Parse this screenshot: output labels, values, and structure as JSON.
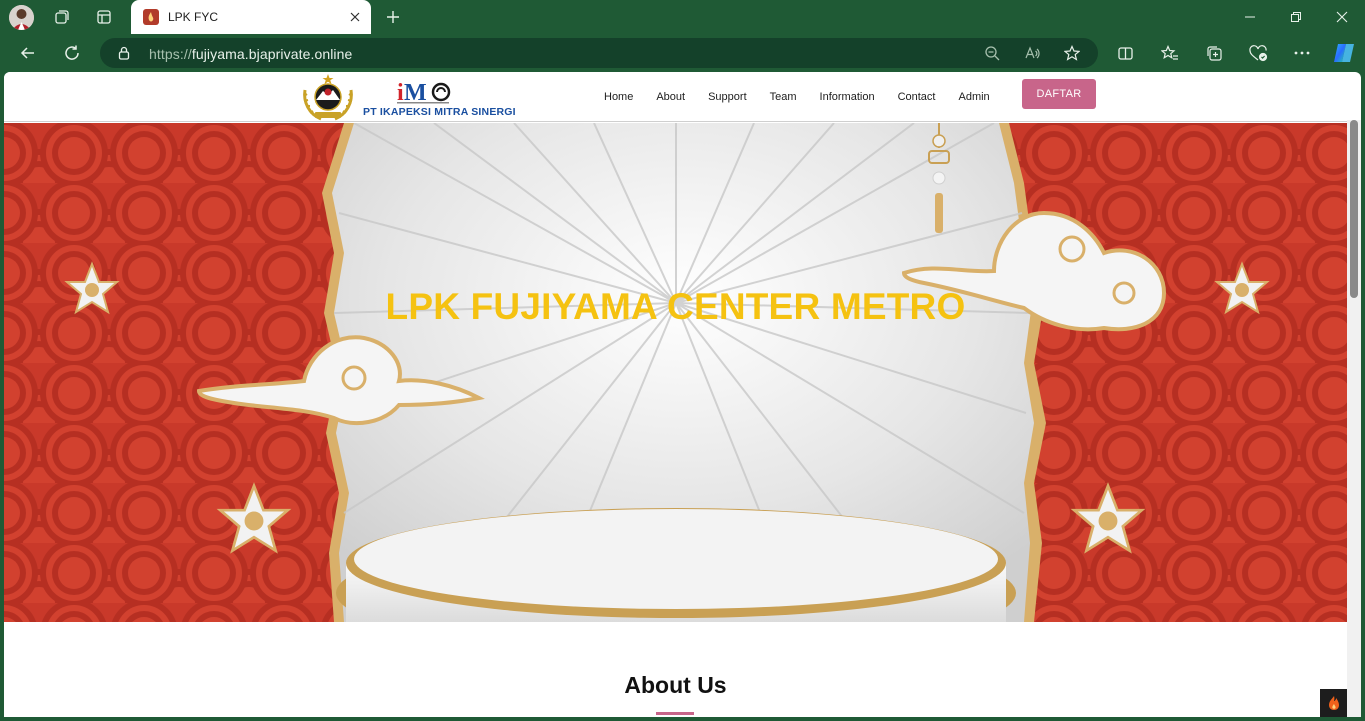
{
  "browser": {
    "tab_title": "LPK FYC",
    "url_protocol": "https://",
    "url_host": "fujiyama.bjaprivate.online",
    "icons": {
      "titlebar": [
        "profile-avatar",
        "workspaces-icon",
        "tab-actions-icon",
        "new-tab-icon",
        "minimize-icon",
        "restore-icon",
        "close-icon"
      ],
      "toolbar": [
        "back-icon",
        "refresh-icon",
        "lock-icon",
        "zoom-out-icon",
        "read-aloud-icon",
        "favorite-star-icon",
        "split-screen-icon",
        "favorites-icon",
        "collections-icon",
        "browser-essentials-icon",
        "more-icon",
        "copilot-icon"
      ]
    }
  },
  "site": {
    "logo_text": "PT IKAPEKSI MITRA SINERGI",
    "nav": [
      "Home",
      "About",
      "Support",
      "Team",
      "Information",
      "Contact",
      "Admin"
    ],
    "cta": "DAFTAR",
    "hero_title": "LPK FUJIYAMA CENTER METRO",
    "about_title": "About Us"
  },
  "colors": {
    "browser_frame": "#1f5a35",
    "address_bar": "#14412a",
    "cta": "#c8658a",
    "hero_title": "#f5c211",
    "hero_red": "#c9392a"
  }
}
